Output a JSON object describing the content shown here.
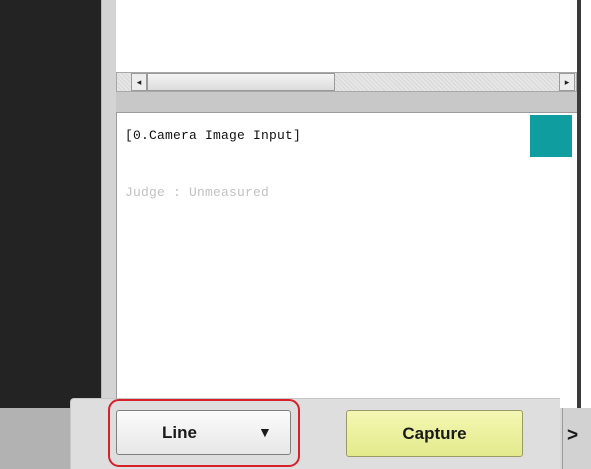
{
  "scrollbar": {
    "left_arrow": "◂",
    "right_arrow": "▸"
  },
  "output": {
    "unit_title": "[0.Camera Image Input]",
    "judge_text": "Judge : Unmeasured",
    "indicator_color": "#0f9da0"
  },
  "toolbar": {
    "mode_select_label": "Line",
    "mode_select_caret": "▼",
    "capture_label": "Capture",
    "more_label": ">",
    "highlight_color": "#d8202a"
  }
}
